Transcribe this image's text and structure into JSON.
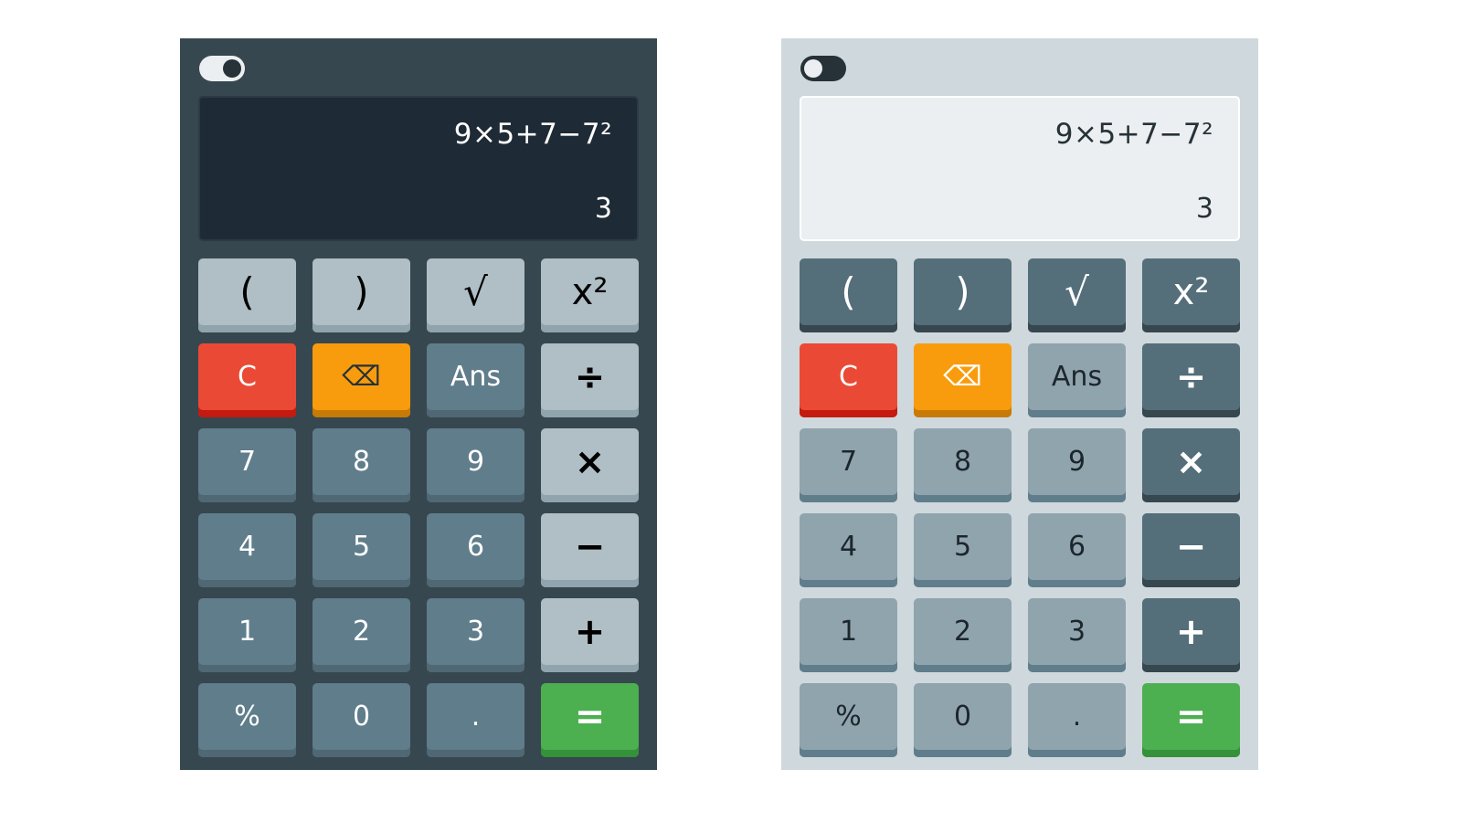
{
  "calculators": {
    "dark": {
      "theme_toggle": "on",
      "display": {
        "expression": "9×5+7−7²",
        "result": "3"
      }
    },
    "light": {
      "theme_toggle": "off",
      "display": {
        "expression": "9×5+7−7²",
        "result": "3"
      }
    }
  },
  "keys": {
    "open_paren": "(",
    "close_paren": ")",
    "sqrt": "√",
    "square": "x²",
    "clear": "C",
    "backspace": "⌫",
    "ans": "Ans",
    "divide": "÷",
    "seven": "7",
    "eight": "8",
    "nine": "9",
    "multiply": "×",
    "four": "4",
    "five": "5",
    "six": "6",
    "minus": "−",
    "one": "1",
    "two": "2",
    "three": "3",
    "plus": "+",
    "percent": "%",
    "zero": "0",
    "decimal": ".",
    "equals": "="
  },
  "colors": {
    "dark_body": "#37474f",
    "light_body": "#cfd8dc",
    "clear": "#ea4a35",
    "backspace": "#f89c0e",
    "equals": "#4caf50"
  }
}
